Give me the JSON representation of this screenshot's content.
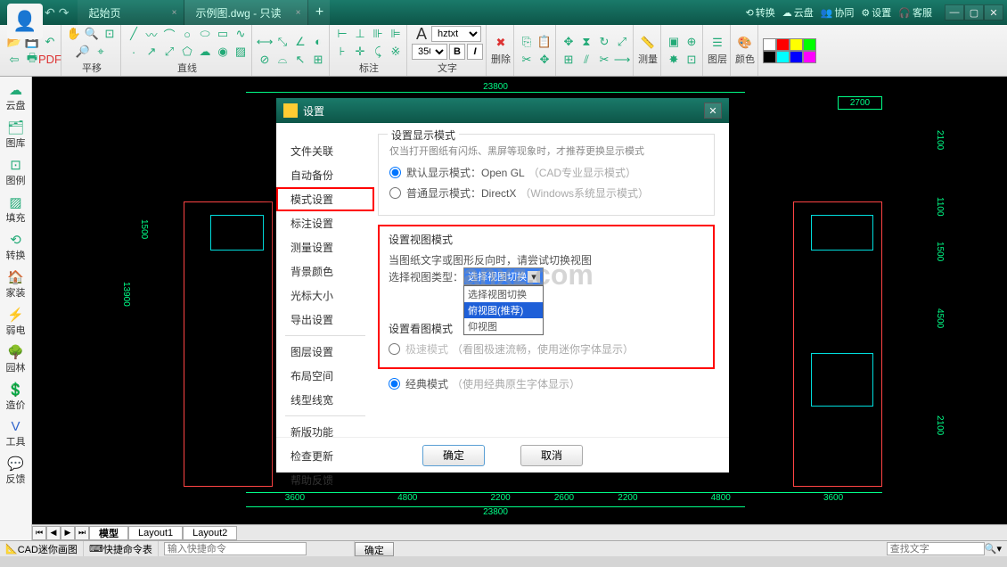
{
  "titlebar": {
    "tabs": [
      {
        "label": "起始页"
      },
      {
        "label": "示例图.dwg - 只读"
      }
    ],
    "right_links": {
      "convert": "转换",
      "cloud": "云盘",
      "collab": "协同",
      "settings": "设置",
      "service": "客服"
    }
  },
  "ribbon": {
    "groups": {
      "g1": "",
      "pan": "平移",
      "line": "直线",
      "annot": "标注",
      "text": "文字",
      "font_name": "hztxt",
      "font_size": "350",
      "delete": "删除",
      "measure": "测量",
      "layer": "图层",
      "color": "颜色"
    }
  },
  "sidebar": {
    "items": [
      {
        "label": "云盘"
      },
      {
        "label": "图库"
      },
      {
        "label": "图例"
      },
      {
        "label": "填充"
      },
      {
        "label": "转换"
      },
      {
        "label": "家装"
      },
      {
        "label": "弱电"
      },
      {
        "label": "园林"
      },
      {
        "label": "造价"
      },
      {
        "label": "工具"
      },
      {
        "label": "反馈"
      }
    ]
  },
  "canvas": {
    "top_dim": "23800",
    "right_dim": "2700",
    "bottom_dim": "23800",
    "dims_bottom": [
      "3600",
      "4800",
      "2200",
      "2600",
      "2200",
      "4800",
      "3600"
    ],
    "dims_right": [
      "2100",
      "1100",
      "1500",
      "4500",
      "2100"
    ],
    "left_dim": "13900",
    "l2": "1500"
  },
  "dialog": {
    "title": "设置",
    "nav": [
      "文件关联",
      "自动备份",
      "模式设置",
      "标注设置",
      "测量设置",
      "背景颜色",
      "光标大小",
      "导出设置",
      "图层设置",
      "布局空间",
      "线型线宽",
      "新版功能",
      "检查更新",
      "帮助反馈"
    ],
    "section1": {
      "legend": "设置显示模式",
      "hint": "仅当打开图纸有闪烁、黑屏等现象时，才推荐更换显示模式",
      "opt1": "默认显示模式：Open GL",
      "opt1_sub": "（CAD专业显示模式）",
      "opt2": "普通显示模式：DirectX",
      "opt2_sub": "（Windows系统显示模式）"
    },
    "section2": {
      "legend": "设置视图模式",
      "hint": "当图纸文字或图形反向时，请尝试切换视图",
      "label": "选择视图类型：",
      "combo_value": "选择视图切换",
      "options": [
        "选择视图切换",
        "俯视图(推荐)",
        "仰视图"
      ]
    },
    "section3": {
      "legend": "设置看图模式",
      "opt1": "极速模式",
      "opt1_sub": "（看图极速流畅，使用迷你字体显示）",
      "opt2": "经典模式",
      "opt2_sub": "（使用经典原生字体显示）"
    },
    "ok": "确定",
    "cancel": "取消"
  },
  "layout_tabs": [
    "模型",
    "Layout1",
    "Layout2"
  ],
  "statusbar": {
    "app": "CAD迷你画图",
    "cmd_label": "快捷命令表",
    "cmd_placeholder": "输入快捷命令",
    "ok": "确定",
    "search_placeholder": "查找文字"
  },
  "watermark": "anxz.com"
}
